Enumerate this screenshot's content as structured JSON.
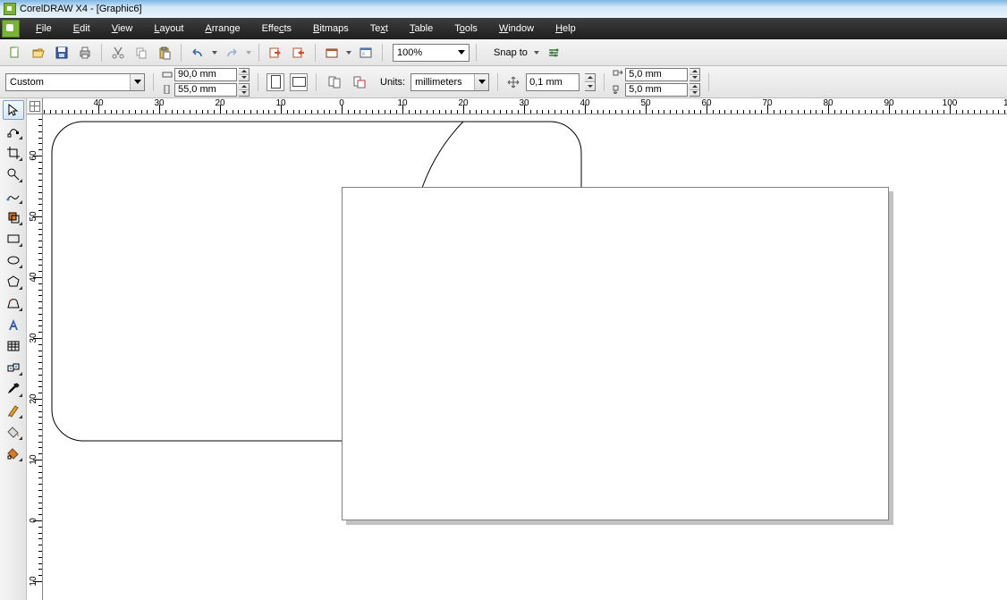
{
  "title": "CorelDRAW X4 - [Graphic6]",
  "menu": {
    "file": "File",
    "edit": "Edit",
    "view": "View",
    "layout": "Layout",
    "arrange": "Arrange",
    "effects": "Effects",
    "bitmaps": "Bitmaps",
    "text": "Text",
    "table": "Table",
    "tools": "Tools",
    "window": "Window",
    "help": "Help"
  },
  "toolbar": {
    "zoom": "100%",
    "snap": "Snap to"
  },
  "property": {
    "paper_preset": "Custom",
    "width": "90,0 mm",
    "height": "55,0 mm",
    "units_label": "Units:",
    "units_value": "millimeters",
    "nudge": "0,1 mm",
    "dup_x": "5,0 mm",
    "dup_y": "5,0 mm"
  },
  "ruler": {
    "h_labels": [
      "40",
      "30",
      "20",
      "10",
      "0",
      "10",
      "20",
      "30",
      "40",
      "50",
      "60",
      "70",
      "80",
      "90",
      "100"
    ],
    "v_labels": [
      "60",
      "50",
      "40",
      "30",
      "20",
      "10",
      "0"
    ]
  }
}
